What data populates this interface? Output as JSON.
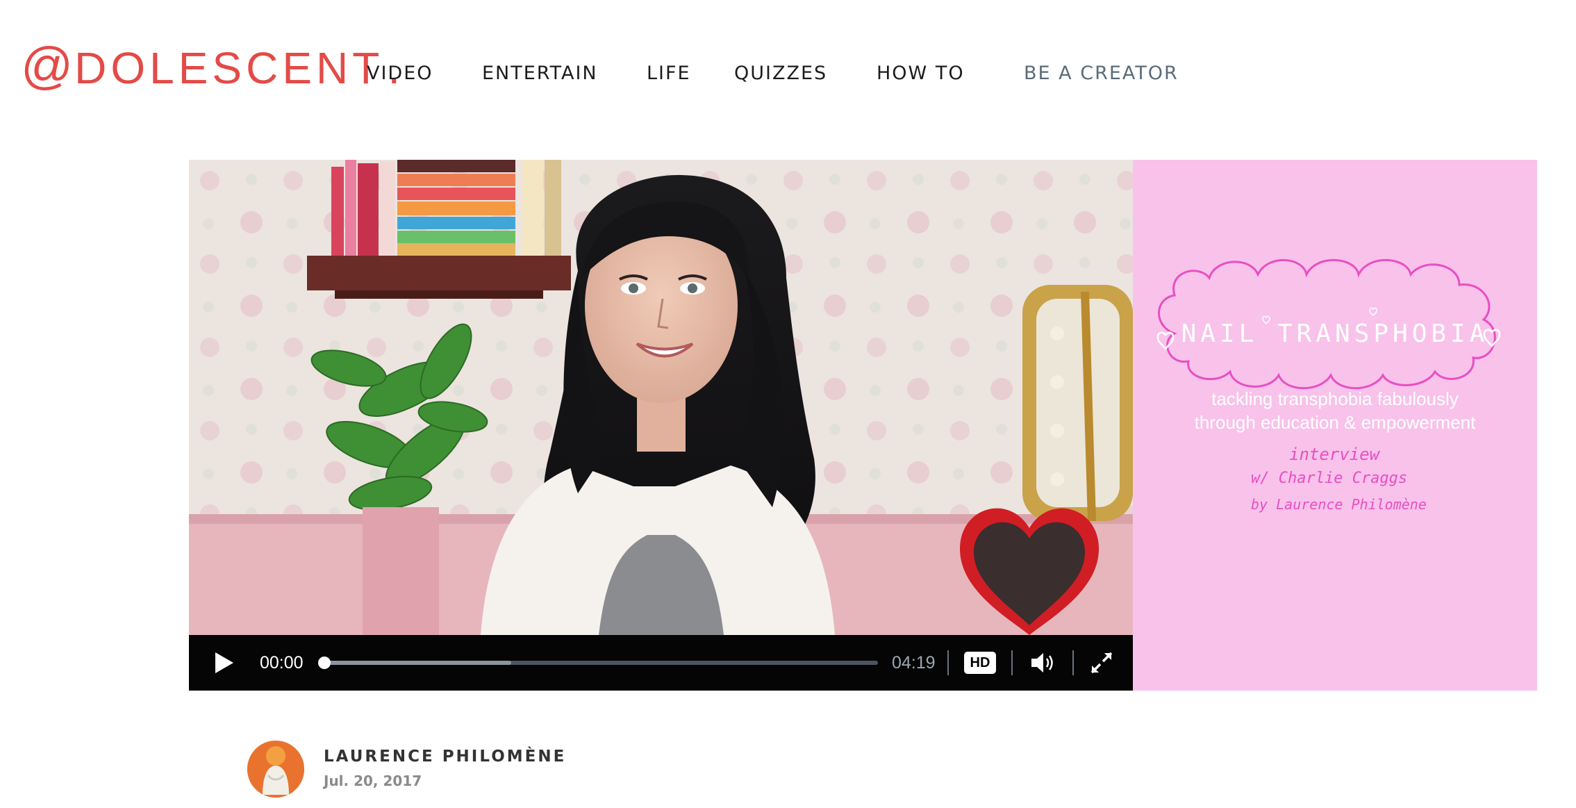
{
  "brand": {
    "logo_at": "@",
    "logo_text": "DOLESCENT",
    "logo_dot": ".",
    "color": "#e34b47"
  },
  "nav": {
    "items": [
      {
        "label": "VIDEO"
      },
      {
        "label": "ENTERTAIN"
      },
      {
        "label": "LIFE"
      },
      {
        "label": "QUIZZES"
      },
      {
        "label": "HOW TO"
      },
      {
        "label": "BE A CREATOR"
      }
    ]
  },
  "video": {
    "current_time": "00:00",
    "total_time": "04:19",
    "hd_label": "HD",
    "progress": 0.0,
    "buffered": 0.34,
    "icons": [
      "play-icon",
      "volume-icon",
      "fullscreen-icon"
    ]
  },
  "title_card": {
    "headline": "NAIL TRANSPHOBIA",
    "subtitle_line1": "tackling transphobia fabulously",
    "subtitle_line2": "through education & empowerment",
    "hand_line1": "interview",
    "hand_line2": "w/ Charlie Craggs",
    "hand_line3": "by Laurence Philomène",
    "background": "#f8c2ea",
    "accent": "#e84fc2"
  },
  "author": {
    "name": "LAURENCE PHILOMÈNE",
    "date": "Jul. 20, 2017"
  }
}
